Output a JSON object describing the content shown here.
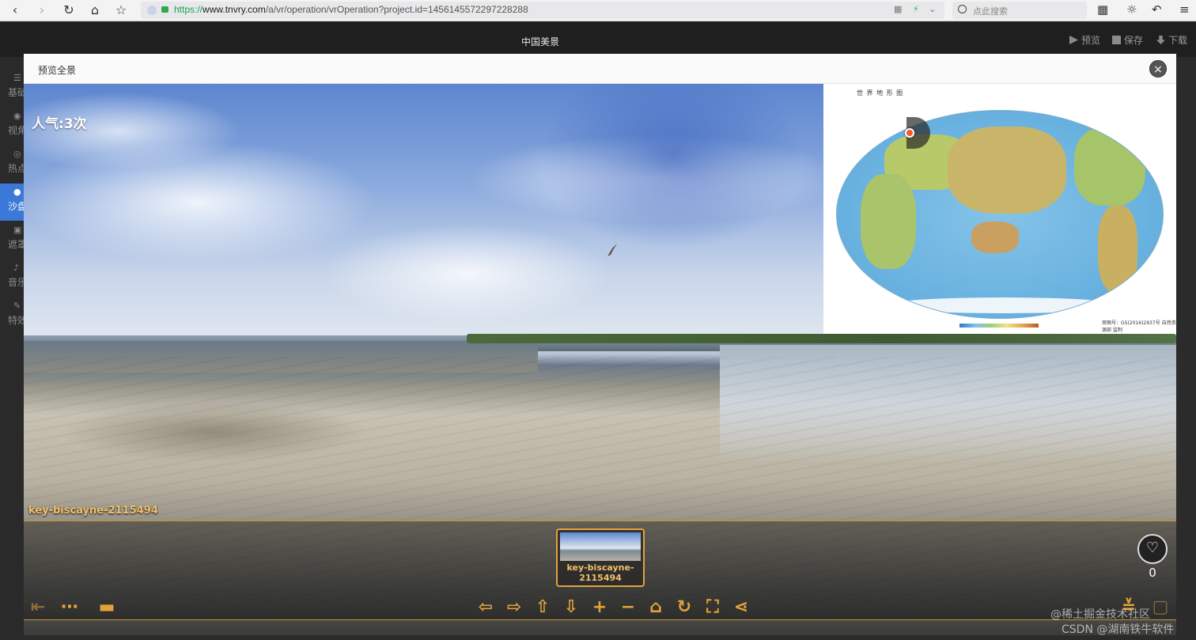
{
  "browser": {
    "url_scheme": "https://",
    "url_host": "www.tnvry.com",
    "url_path": "/a/vr/operation/vrOperation?project.id=1456145572297228288",
    "search_placeholder": "点此搜索"
  },
  "header": {
    "title": "中国美景",
    "preview_label": "预览",
    "save_label": "保存",
    "download_label": "下载"
  },
  "sidebar": {
    "items": [
      {
        "label": "基础",
        "icon": "list-icon"
      },
      {
        "label": "视角",
        "icon": "eye-icon"
      },
      {
        "label": "热点",
        "icon": "target-icon"
      },
      {
        "label": "沙盘",
        "icon": "pin-icon"
      },
      {
        "label": "遮罩",
        "icon": "image-icon"
      },
      {
        "label": "音乐",
        "icon": "music-icon"
      },
      {
        "label": "特效",
        "icon": "wand-icon"
      }
    ]
  },
  "modal": {
    "title": "预览全景",
    "close_icon": "×",
    "popularity": "人气:3次",
    "map_title": "世 界 地 形 图",
    "map_note": "审图号：GS(2016)2937号 自然资源部 监制",
    "scene_name": "key-biscayne-2115494",
    "thumb_label": "key-biscayne-2115494",
    "like_count": "0"
  },
  "watermark": {
    "line1": "@稀土掘金技术社区",
    "line2": "CSDN @湖南铁牛软件"
  },
  "colors": {
    "accent": "#e3a33b",
    "active_sidebar": "#3c78d8"
  }
}
